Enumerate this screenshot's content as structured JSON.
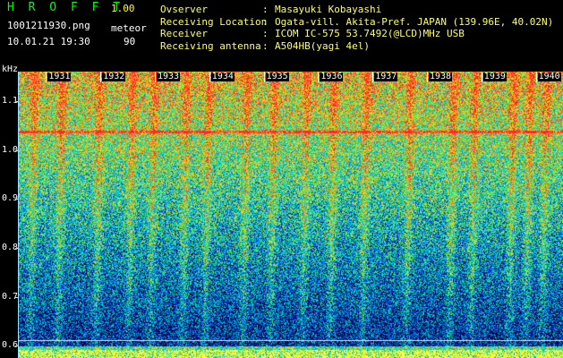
{
  "header": {
    "app_title": "H R O F F T",
    "version": "1.00",
    "file_name": "1001211930.png",
    "date_time": "10.01.21 19:30",
    "mode_label": "meteor",
    "mode_count": "90"
  },
  "info": [
    {
      "key": "Ovserver",
      "sep": ":",
      "value": "Masayuki Kobayashi"
    },
    {
      "key": "Receiving Location",
      "sep": ":",
      "value": "Ogata-vill. Akita-Pref. JAPAN (139.96E, 40.02N)"
    },
    {
      "key": "Receiver",
      "sep": ":",
      "value": "ICOM IC-575 53.7492(@LCD)MHz USB"
    },
    {
      "key": "Receiving antenna",
      "sep": ":",
      "value": "A504HB(yagi 4el)"
    }
  ],
  "colors": {
    "title": "#00ff00",
    "version": "#ffff00",
    "header_text": "#ffffff",
    "info_text": "#ffff66",
    "axis": "#9ae0ff",
    "tick_label": "#ffffff"
  },
  "spectrogram": {
    "y_unit": "kHz",
    "y_ticks": [
      "1.1",
      "1.0",
      "0.9",
      "0.8",
      "0.7",
      "0.6"
    ],
    "y_tick_values": [
      1.1,
      1.0,
      0.9,
      0.8,
      0.7,
      0.6
    ],
    "y_range": [
      0.575,
      1.16
    ],
    "x_ticks": [
      "1931",
      "1932",
      "1933",
      "1934",
      "1935",
      "1936",
      "1937",
      "1938",
      "1939",
      "1940"
    ],
    "x_range_minutes": [
      1930.5,
      1940.5
    ],
    "carrier_khz": 1.037,
    "reference_line_khz": 0.612,
    "meteor_trails_minutes": [
      1930.7,
      1931.2,
      1931.9,
      1932.5,
      1932.9,
      1933.5,
      1933.9,
      1934.6,
      1935.1,
      1935.7,
      1936.2,
      1936.8,
      1937.6,
      1938.4,
      1938.8,
      1939.5,
      1939.8,
      1940.1
    ]
  }
}
